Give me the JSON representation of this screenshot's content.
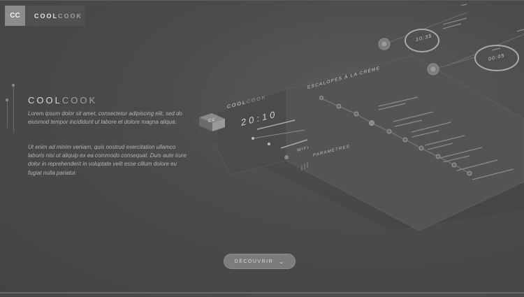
{
  "header": {
    "logo_mark": "CC",
    "brand_a": "COOL",
    "brand_b": "COOK"
  },
  "hero": {
    "title_a": "COOL",
    "title_b": "COOK",
    "paragraph1": "Lorem ipsum dolor sit amet, consectetur adipiscing elit, sed do eiusmod tempor incididunt ut labore et dolore magna aliqua.",
    "paragraph2": "Ut enim ad minim veniam, quis nostrud exercitation ullamco laboris nisi ut aliquip ex ea commodo consequat. Duis aute irure dolor in reprehenderit in voluptate velit esse cillum dolore eu fugiat nulla pariatur."
  },
  "mockup": {
    "logo_mark": "CC",
    "brand_a": "COOL",
    "brand_b": "COOK",
    "time": "20:10",
    "wifi_label": "WIFI",
    "params_label": "PARAMÈTRES",
    "recipe_title": "ESCALOPES À LA CRÈME",
    "timer1_value": "10:35",
    "timer2_value": "00:05"
  },
  "cta": {
    "label": "DÉCOUVRIR"
  }
}
